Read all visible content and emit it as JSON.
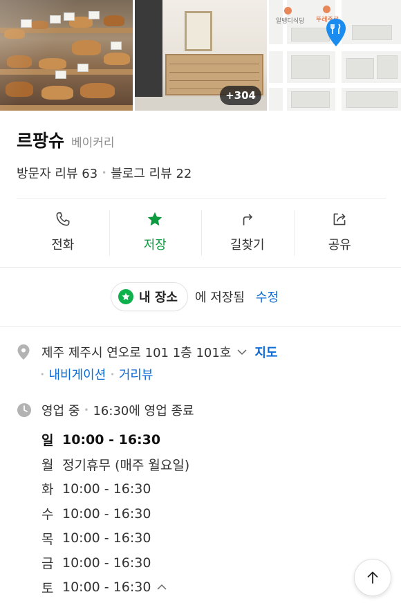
{
  "photos": {
    "more_count": "+304",
    "map_poi_1": "알뱅디식당",
    "map_poi_2": "뚜레주르"
  },
  "place": {
    "name": "르팡슈",
    "category": "베이커리",
    "visitor_reviews": "방문자 리뷰 63",
    "blog_reviews": "블로그 리뷰 22"
  },
  "actions": [
    {
      "label": "전화",
      "icon": "phone-icon"
    },
    {
      "label": "저장",
      "icon": "star-icon"
    },
    {
      "label": "길찾기",
      "icon": "directions-icon"
    },
    {
      "label": "공유",
      "icon": "share-icon"
    }
  ],
  "saved": {
    "list_name": "내 장소",
    "suffix": "에 저장됨",
    "edit": "수정"
  },
  "address": {
    "text": "제주 제주시 연오로 101 1층 101호",
    "map_link": "지도",
    "navigation": "내비게이션",
    "street_view": "거리뷰"
  },
  "hours": {
    "status": "영업 중",
    "close_note": "16:30에 영업 종료",
    "days": [
      {
        "day": "일",
        "time": "10:00 - 16:30"
      },
      {
        "day": "월",
        "time": "정기휴무 (매주 월요일)"
      },
      {
        "day": "화",
        "time": "10:00 - 16:30"
      },
      {
        "day": "수",
        "time": "10:00 - 16:30"
      },
      {
        "day": "목",
        "time": "10:00 - 16:30"
      },
      {
        "day": "금",
        "time": "10:00 - 16:30"
      },
      {
        "day": "토",
        "time": "10:00 - 16:30"
      }
    ]
  },
  "colors": {
    "accent_green": "#0eb14b",
    "link_blue": "#0d6bd6",
    "map_pin": "#1a8cf0"
  }
}
